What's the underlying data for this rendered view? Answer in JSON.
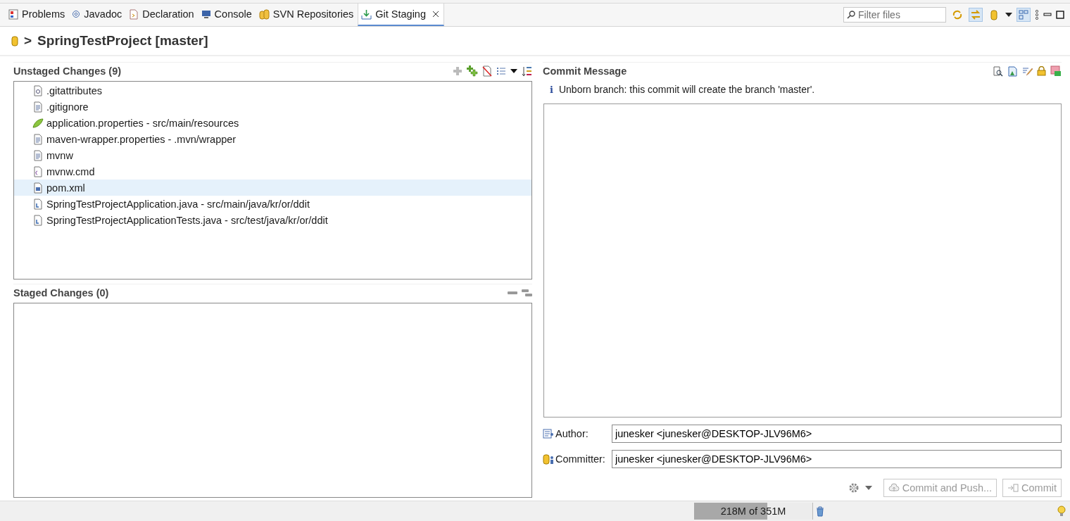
{
  "tabs": [
    {
      "label": "Problems",
      "kind": "problems",
      "selected": false,
      "closable": false
    },
    {
      "label": "Javadoc",
      "kind": "javadoc",
      "selected": false,
      "closable": false
    },
    {
      "label": "Declaration",
      "kind": "declaration",
      "selected": false,
      "closable": false
    },
    {
      "label": "Console",
      "kind": "console",
      "selected": false,
      "closable": false
    },
    {
      "label": "SVN Repositories",
      "kind": "svn",
      "selected": false,
      "closable": false
    },
    {
      "label": "Git Staging",
      "kind": "git",
      "selected": true,
      "closable": true
    }
  ],
  "filter": {
    "placeholder": "Filter files"
  },
  "repository": {
    "arrow": ">",
    "title": "SpringTestProject [master]"
  },
  "unstaged": {
    "title": "Unstaged Changes (9)",
    "files": [
      {
        "name": ".gitattributes",
        "kind": "config",
        "selected": false
      },
      {
        "name": ".gitignore",
        "kind": "text",
        "selected": false
      },
      {
        "name": "application.properties - src/main/resources",
        "kind": "spring",
        "selected": false
      },
      {
        "name": "maven-wrapper.properties - .mvn/wrapper",
        "kind": "text",
        "selected": false
      },
      {
        "name": "mvnw",
        "kind": "text",
        "selected": false
      },
      {
        "name": "mvnw.cmd",
        "kind": "cmd",
        "selected": false
      },
      {
        "name": "pom.xml",
        "kind": "xml",
        "selected": true
      },
      {
        "name": "SpringTestProjectApplication.java - src/main/java/kr/or/ddit",
        "kind": "java",
        "selected": false
      },
      {
        "name": "SpringTestProjectApplicationTests.java - src/test/java/kr/or/ddit",
        "kind": "java",
        "selected": false
      }
    ]
  },
  "staged": {
    "title": "Staged Changes (0)"
  },
  "commit": {
    "title": "Commit Message",
    "info_icon": "i",
    "info": "Unborn branch: this commit will create the branch 'master'.",
    "author_label": "Author:",
    "author": "junesker <junesker@DESKTOP-JLV96M6>",
    "committer_label": "Committer:",
    "committer": "junesker <junesker@DESKTOP-JLV96M6>",
    "buttons": [
      {
        "label": "Commit and Push...",
        "kind": "push",
        "disabled": true
      },
      {
        "label": "Commit",
        "kind": "commit",
        "disabled": true
      }
    ]
  },
  "status_bar": {
    "memory": "218M of 351M",
    "level": 0.62
  }
}
